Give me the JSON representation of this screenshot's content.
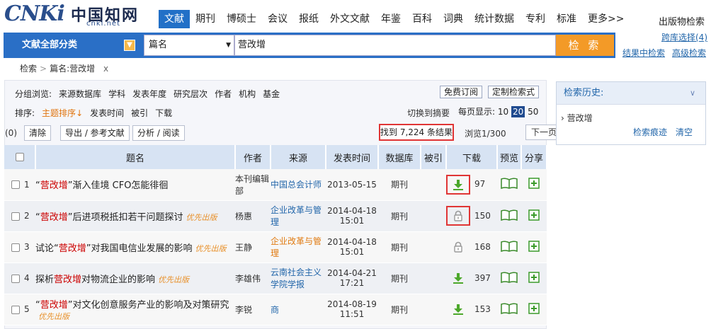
{
  "logo": {
    "mark": "CNKi",
    "cn": "中国知网",
    "url": "cnki.net"
  },
  "nav": [
    "文献",
    "期刊",
    "博硕士",
    "会议",
    "报纸",
    "外文文献",
    "年鉴",
    "百科",
    "词典",
    "统计数据",
    "专利",
    "标准",
    "更多>>"
  ],
  "pub_search": "出版物检索",
  "search": {
    "category_label": "文献全部分类",
    "field": "篇名",
    "query": "营改增",
    "button": "检 索"
  },
  "links": {
    "cross_db": "跨库选择(4)",
    "in_results": "结果中检索",
    "advanced": "高级检索"
  },
  "breadcrumb": {
    "root": "检索",
    "current": "篇名:营改增",
    "close": "x"
  },
  "filters": {
    "label": "分组浏览:",
    "items": [
      "来源数据库",
      "学科",
      "发表年度",
      "研究层次",
      "作者",
      "机构",
      "基金"
    ],
    "free_subscribe": "免费订阅",
    "custom_search": "定制检索式"
  },
  "sort": {
    "label": "排序:",
    "topic": "主题排序",
    "items": [
      "发表时间",
      "被引",
      "下载"
    ],
    "switch": "切换到摘要",
    "per_page_label": "每页显示:",
    "sizes": [
      "10",
      "20",
      "50"
    ],
    "active_size": "20"
  },
  "actions": {
    "selected": "(0)",
    "clear": "清除",
    "export": "导出 / 参考文献",
    "analyze": "分析 / 阅读"
  },
  "results": {
    "found": "找到 7,224 条结果",
    "page": "浏览1/300",
    "next": "下一页"
  },
  "table": {
    "headers": [
      "题名",
      "作者",
      "来源",
      "发表时间",
      "数据库",
      "被引",
      "下载",
      "预览",
      "分享"
    ],
    "rows": [
      {
        "n": "1",
        "pre": "“",
        "hl": "营改增",
        "post": "”渐入佳境 CFO怎能徘徊",
        "prio": "",
        "author": "本刊编辑部",
        "source": "中国总会计师",
        "src_color": "blue",
        "date": "2013-05-15",
        "time": "",
        "db": "期刊",
        "cited": "",
        "downloads": "97",
        "dl": "download"
      },
      {
        "n": "2",
        "pre": "“",
        "hl": "营改增",
        "post": "”后进项税抵扣若干问题探讨",
        "prio": "优先出版",
        "author": "杨惠",
        "source": "企业改革与管理",
        "src_color": "blue",
        "date": "2014-04-18",
        "time": "15:01",
        "db": "期刊",
        "cited": "",
        "downloads": "150",
        "dl": "locked"
      },
      {
        "n": "3",
        "pre": "试论“",
        "hl": "营改增",
        "post": "”对我国电信业发展的影响",
        "prio": "优先出版",
        "author": "王静",
        "source": "企业改革与管理",
        "src_color": "orange",
        "date": "2014-04-18",
        "time": "15:01",
        "db": "期刊",
        "cited": "",
        "downloads": "168",
        "dl": "locked"
      },
      {
        "n": "4",
        "pre": "探析",
        "hl": "营改增",
        "post": "对物流企业的影响",
        "prio": "优先出版",
        "author": "李雄伟",
        "source": "云南社会主义学院学报",
        "src_color": "blue",
        "date": "2014-04-21",
        "time": "17:21",
        "db": "期刊",
        "cited": "",
        "downloads": "397",
        "dl": "download"
      },
      {
        "n": "5",
        "pre": "“",
        "hl": "营改增",
        "post": "”对文化创意服务产业的影响及对策研究",
        "prio": "优先出版",
        "author": "李锐",
        "source": "商",
        "src_color": "blue",
        "date": "2014-08-19",
        "time": "11:51",
        "db": "期刊",
        "cited": "",
        "downloads": "153",
        "dl": "download"
      }
    ]
  },
  "history": {
    "title": "检索历史:",
    "entry": "营改增",
    "trace": "检索痕迹",
    "clear": "清空"
  },
  "colors": {
    "brand_blue": "#2a6fc6",
    "search_orange": "#f39a27",
    "highlight_red": "#cc0000",
    "link_blue": "#2266aa"
  }
}
